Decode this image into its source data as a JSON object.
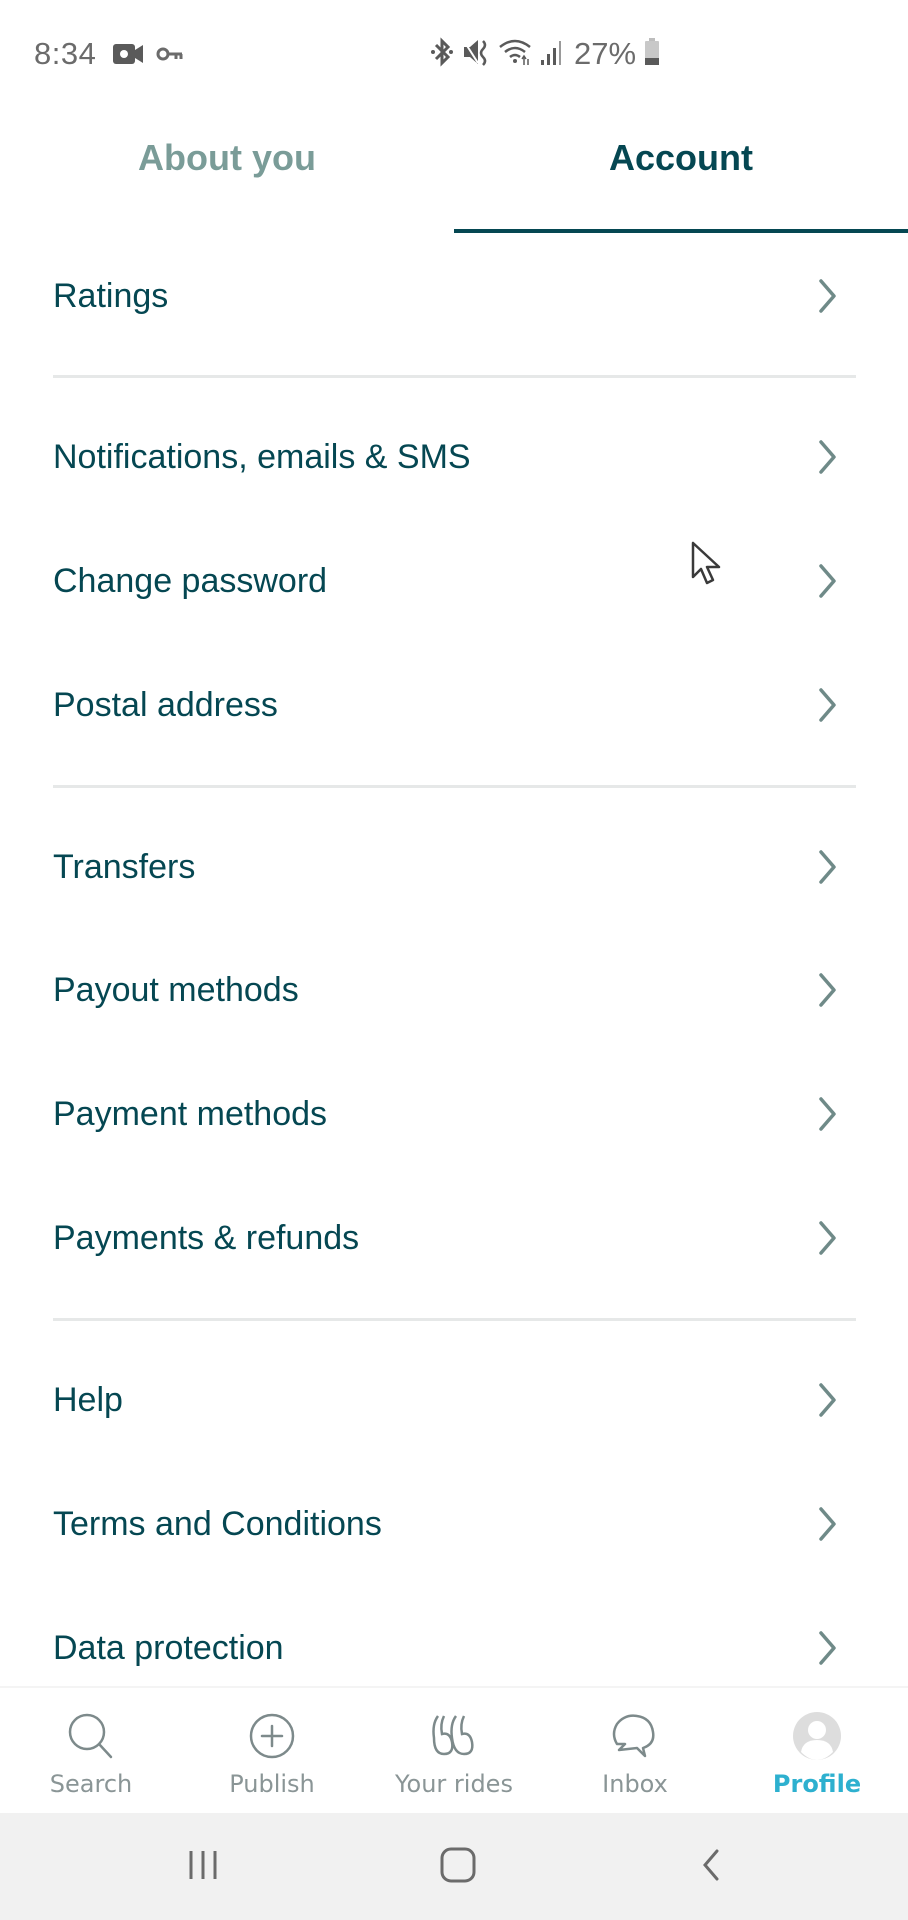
{
  "status_bar": {
    "time": "8:34",
    "battery_percent": "27%",
    "left_icons": [
      "video-recording-icon",
      "vpn-key-icon"
    ],
    "right_icons": [
      "bluetooth-icon",
      "mute-icon",
      "wifi-icon",
      "signal-icon",
      "battery-icon"
    ]
  },
  "tabs": [
    {
      "label": "About you",
      "active": false
    },
    {
      "label": "Account",
      "active": true
    }
  ],
  "list": {
    "items": [
      {
        "label": "Ratings"
      },
      {
        "label": "Notifications, emails & SMS"
      },
      {
        "label": "Change password"
      },
      {
        "label": "Postal address"
      },
      {
        "label": "Transfers"
      },
      {
        "label": "Payout methods"
      },
      {
        "label": "Payment methods"
      },
      {
        "label": "Payments & refunds"
      },
      {
        "label": "Help"
      },
      {
        "label": "Terms and Conditions"
      },
      {
        "label": "Data protection"
      }
    ]
  },
  "bottom_nav": {
    "items": [
      {
        "label": "Search",
        "icon": "search-icon",
        "active": false
      },
      {
        "label": "Publish",
        "icon": "plus-circle-icon",
        "active": false
      },
      {
        "label": "Your rides",
        "icon": "rides-icon",
        "active": false
      },
      {
        "label": "Inbox",
        "icon": "chat-icon",
        "active": false
      },
      {
        "label": "Profile",
        "icon": "avatar-icon",
        "active": true
      }
    ]
  },
  "system_nav": {
    "buttons": [
      "recent-apps",
      "home",
      "back"
    ]
  },
  "colors": {
    "primary_text": "#054752",
    "inactive_tab": "#7a9c98",
    "active_nav": "#2db0cf",
    "inactive_nav": "#8a9596",
    "divider": "#e6e8e8"
  }
}
